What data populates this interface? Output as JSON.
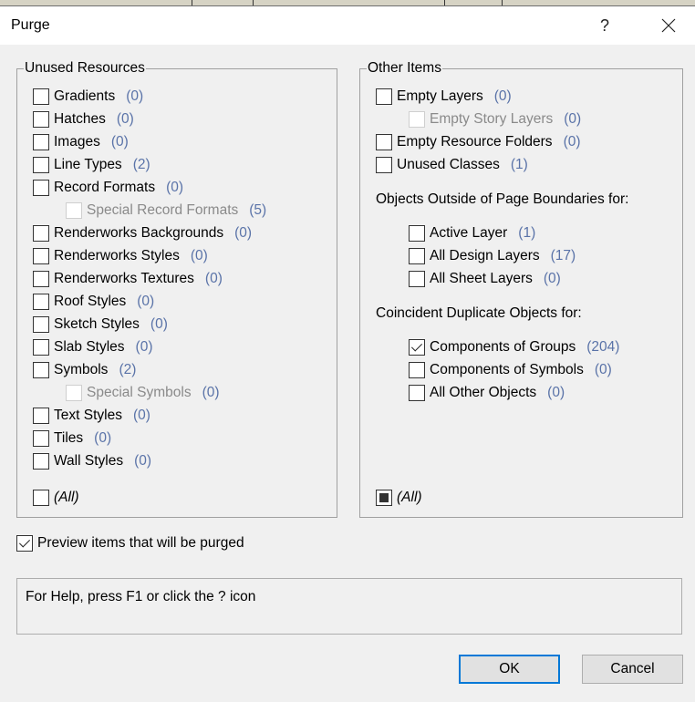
{
  "window": {
    "title": "Purge",
    "help_glyph": "?",
    "close_glyph": "✕"
  },
  "unused_resources": {
    "legend": "Unused Resources",
    "items": [
      {
        "label": "Gradients",
        "count": "(0)",
        "checked": false,
        "disabled": false,
        "indent": false
      },
      {
        "label": "Hatches",
        "count": "(0)",
        "checked": false,
        "disabled": false,
        "indent": false
      },
      {
        "label": "Images",
        "count": "(0)",
        "checked": false,
        "disabled": false,
        "indent": false
      },
      {
        "label": "Line Types",
        "count": "(2)",
        "checked": false,
        "disabled": false,
        "indent": false
      },
      {
        "label": "Record Formats",
        "count": "(0)",
        "checked": false,
        "disabled": false,
        "indent": false
      },
      {
        "label": "Special Record Formats",
        "count": "(5)",
        "checked": false,
        "disabled": true,
        "indent": true
      },
      {
        "label": "Renderworks Backgrounds",
        "count": "(0)",
        "checked": false,
        "disabled": false,
        "indent": false
      },
      {
        "label": "Renderworks Styles",
        "count": "(0)",
        "checked": false,
        "disabled": false,
        "indent": false
      },
      {
        "label": "Renderworks Textures",
        "count": "(0)",
        "checked": false,
        "disabled": false,
        "indent": false
      },
      {
        "label": "Roof Styles",
        "count": "(0)",
        "checked": false,
        "disabled": false,
        "indent": false
      },
      {
        "label": "Sketch Styles",
        "count": "(0)",
        "checked": false,
        "disabled": false,
        "indent": false
      },
      {
        "label": "Slab Styles",
        "count": "(0)",
        "checked": false,
        "disabled": false,
        "indent": false
      },
      {
        "label": "Symbols",
        "count": "(2)",
        "checked": false,
        "disabled": false,
        "indent": false
      },
      {
        "label": "Special Symbols",
        "count": "(0)",
        "checked": false,
        "disabled": true,
        "indent": true
      },
      {
        "label": "Text Styles",
        "count": "(0)",
        "checked": false,
        "disabled": false,
        "indent": false
      },
      {
        "label": "Tiles",
        "count": "(0)",
        "checked": false,
        "disabled": false,
        "indent": false
      },
      {
        "label": "Wall Styles",
        "count": "(0)",
        "checked": false,
        "disabled": false,
        "indent": false
      }
    ],
    "all": {
      "label": "(All)",
      "state": "unchecked"
    }
  },
  "other_items": {
    "legend": "Other Items",
    "items": [
      {
        "label": "Empty Layers",
        "count": "(0)",
        "checked": false,
        "disabled": false,
        "indent": false
      },
      {
        "label": "Empty Story Layers",
        "count": "(0)",
        "checked": false,
        "disabled": true,
        "indent": true
      },
      {
        "label": "Empty Resource Folders",
        "count": "(0)",
        "checked": false,
        "disabled": false,
        "indent": false
      },
      {
        "label": "Unused Classes",
        "count": "(1)",
        "checked": false,
        "disabled": false,
        "indent": false
      }
    ],
    "outside_page_heading": "Objects Outside of Page Boundaries for:",
    "outside_page_items": [
      {
        "label": "Active Layer",
        "count": "(1)",
        "checked": false
      },
      {
        "label": "All Design Layers",
        "count": "(17)",
        "checked": false
      },
      {
        "label": "All Sheet Layers",
        "count": "(0)",
        "checked": false
      }
    ],
    "duplicates_heading": "Coincident Duplicate Objects for:",
    "duplicates_items": [
      {
        "label": "Components of Groups",
        "count": "(204)",
        "checked": true
      },
      {
        "label": "Components of Symbols",
        "count": "(0)",
        "checked": false
      },
      {
        "label": "All Other Objects",
        "count": "(0)",
        "checked": false
      }
    ],
    "all": {
      "label": "(All)",
      "state": "mixed"
    }
  },
  "preview": {
    "label": "Preview items that will be purged",
    "checked": true
  },
  "help_text": "For Help, press F1 or click the ? icon",
  "buttons": {
    "ok": "OK",
    "cancel": "Cancel"
  },
  "colors": {
    "count_text": "#5a73a8",
    "default_button_border": "#0078d7"
  }
}
